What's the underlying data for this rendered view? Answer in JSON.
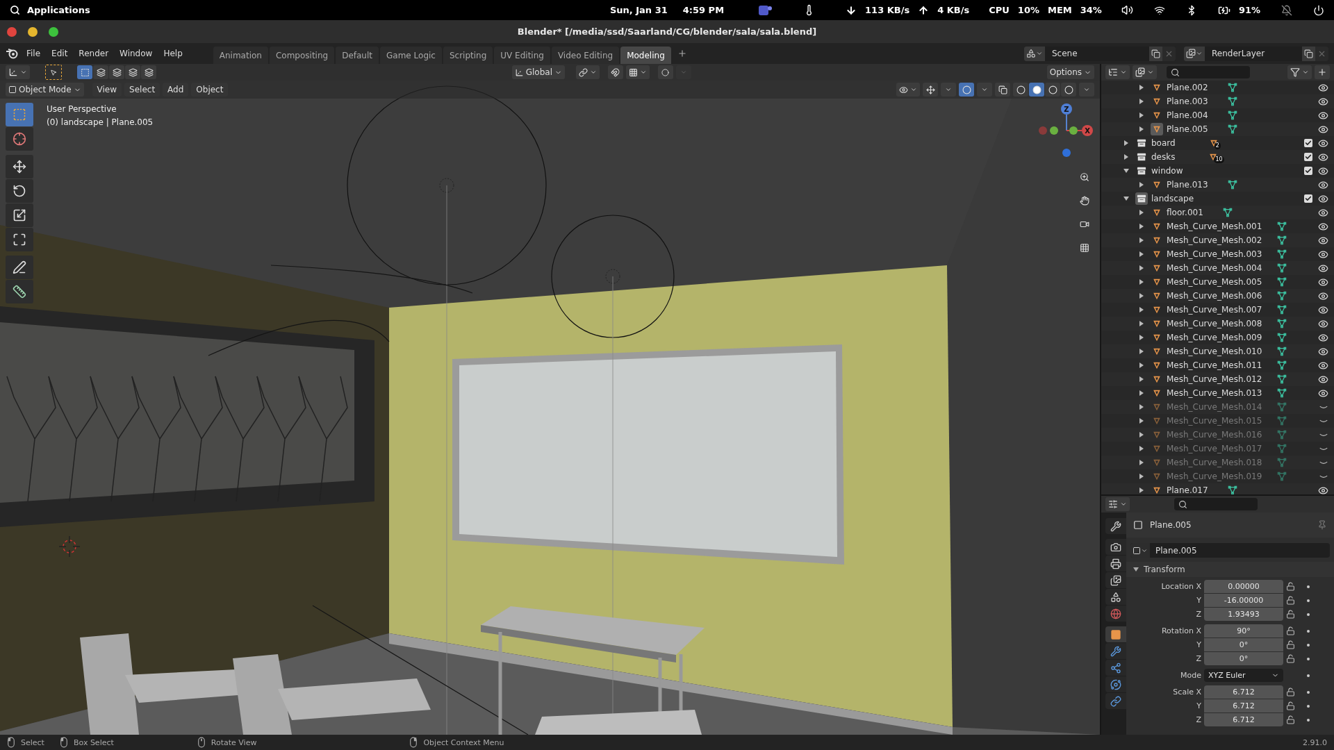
{
  "system_bar": {
    "launcher": "Applications",
    "date": "Sun, Jan 31",
    "time": "4:59 PM",
    "download": "113 KB/s",
    "upload": "4 KB/s",
    "cpu_label": "CPU",
    "cpu": "10%",
    "mem_label": "MEM",
    "mem": "34%",
    "battery": "91%"
  },
  "window": {
    "title": "Blender* [/media/ssd/Saarland/CG/blender/sala/sala.blend]"
  },
  "menu": [
    "File",
    "Edit",
    "Render",
    "Window",
    "Help"
  ],
  "workspaces": [
    {
      "label": "Animation",
      "selected": false
    },
    {
      "label": "Compositing",
      "selected": false
    },
    {
      "label": "Default",
      "selected": false
    },
    {
      "label": "Game Logic",
      "selected": false
    },
    {
      "label": "Scripting",
      "selected": false
    },
    {
      "label": "UV Editing",
      "selected": false
    },
    {
      "label": "Video Editing",
      "selected": false
    },
    {
      "label": "Modeling",
      "selected": true
    }
  ],
  "scene": "Scene",
  "view_layer": "RenderLayer",
  "tool_header": {
    "select_modes": [
      {
        "selected": true
      },
      {
        "selected": false
      },
      {
        "selected": false
      },
      {
        "selected": false
      },
      {
        "selected": false
      }
    ],
    "orientation": "Global",
    "options": "Options"
  },
  "viewport_header": {
    "mode": "Object Mode",
    "menus": [
      "View",
      "Select",
      "Add",
      "Object"
    ],
    "shading": [
      {
        "selected": false
      },
      {
        "selected": true
      },
      {
        "selected": false
      },
      {
        "selected": false
      }
    ]
  },
  "viewport": {
    "view_name": "User Perspective",
    "context": "(0) landscape | Plane.005",
    "gizmo_axes": [
      "X",
      "Z"
    ]
  },
  "toolbar": {
    "groups": [
      {
        "tools": [
          {
            "kind": "select",
            "selected": true
          },
          {
            "kind": "cursor",
            "selected": false
          }
        ]
      },
      {
        "tools": [
          {
            "kind": "move",
            "selected": false
          },
          {
            "kind": "rotate",
            "selected": false
          },
          {
            "kind": "scale",
            "selected": false
          },
          {
            "kind": "transform",
            "selected": false
          }
        ]
      },
      {
        "tools": [
          {
            "kind": "annotate",
            "selected": false
          },
          {
            "kind": "measure",
            "selected": false
          }
        ]
      }
    ]
  },
  "outliner": {
    "scrolled_children": [
      {
        "name": "Plane.002",
        "visible": true,
        "selected": false
      },
      {
        "name": "Plane.003",
        "visible": true,
        "selected": false
      },
      {
        "name": "Plane.004",
        "visible": true,
        "selected": false
      },
      {
        "name": "Plane.005",
        "visible": true,
        "selected": true
      }
    ],
    "collections": [
      {
        "name": "board",
        "count": "2",
        "expanded": false,
        "checked": true,
        "selected": false
      },
      {
        "name": "desks",
        "count": "10",
        "expanded": false,
        "checked": true,
        "selected": false
      },
      {
        "name": "window",
        "expanded": true,
        "checked": true,
        "selected": false,
        "children": [
          {
            "name": "Plane.013",
            "visible": true,
            "selected": false
          }
        ]
      },
      {
        "name": "landscape",
        "expanded": true,
        "checked": true,
        "selected": true,
        "children": [
          {
            "name": "floor.001",
            "visible": true,
            "selected": false
          },
          {
            "name": "Mesh_Curve_Mesh.001",
            "visible": true,
            "selected": false
          },
          {
            "name": "Mesh_Curve_Mesh.002",
            "visible": true,
            "selected": false
          },
          {
            "name": "Mesh_Curve_Mesh.003",
            "visible": true,
            "selected": false
          },
          {
            "name": "Mesh_Curve_Mesh.004",
            "visible": true,
            "selected": false
          },
          {
            "name": "Mesh_Curve_Mesh.005",
            "visible": true,
            "selected": false
          },
          {
            "name": "Mesh_Curve_Mesh.006",
            "visible": true,
            "selected": false
          },
          {
            "name": "Mesh_Curve_Mesh.007",
            "visible": true,
            "selected": false
          },
          {
            "name": "Mesh_Curve_Mesh.008",
            "visible": true,
            "selected": false
          },
          {
            "name": "Mesh_Curve_Mesh.009",
            "visible": true,
            "selected": false
          },
          {
            "name": "Mesh_Curve_Mesh.010",
            "visible": true,
            "selected": false
          },
          {
            "name": "Mesh_Curve_Mesh.011",
            "visible": true,
            "selected": false
          },
          {
            "name": "Mesh_Curve_Mesh.012",
            "visible": true,
            "selected": false
          },
          {
            "name": "Mesh_Curve_Mesh.013",
            "visible": true,
            "selected": false
          },
          {
            "name": "Mesh_Curve_Mesh.014",
            "visible": false,
            "selected": false
          },
          {
            "name": "Mesh_Curve_Mesh.015",
            "visible": false,
            "selected": false
          },
          {
            "name": "Mesh_Curve_Mesh.016",
            "visible": false,
            "selected": false
          },
          {
            "name": "Mesh_Curve_Mesh.017",
            "visible": false,
            "selected": false
          },
          {
            "name": "Mesh_Curve_Mesh.018",
            "visible": false,
            "selected": false
          },
          {
            "name": "Mesh_Curve_Mesh.019",
            "visible": false,
            "selected": false
          },
          {
            "name": "Plane.017",
            "visible": true,
            "selected": false
          }
        ]
      }
    ]
  },
  "properties": {
    "tabs": [
      {
        "kind": "tool",
        "selected": false
      },
      {
        "kind": "render",
        "selected": false
      },
      {
        "kind": "output",
        "selected": false
      },
      {
        "kind": "view_layer",
        "selected": false
      },
      {
        "kind": "scene",
        "selected": false
      },
      {
        "kind": "world",
        "selected": false
      },
      {
        "kind": "object",
        "selected": true
      },
      {
        "kind": "modifiers",
        "selected": false
      },
      {
        "kind": "particles",
        "selected": false
      },
      {
        "kind": "physics",
        "selected": false
      },
      {
        "kind": "constraints",
        "selected": false
      }
    ],
    "object_name": "Plane.005",
    "data_name": "Plane.005",
    "panel": {
      "title": "Transform",
      "expanded": true
    },
    "groups": [
      {
        "rows": [
          {
            "kind": "number",
            "label": "Location X",
            "value": "0.00000"
          },
          {
            "kind": "number",
            "label": "Y",
            "value": "-16.00000"
          },
          {
            "kind": "number",
            "label": "Z",
            "value": "1.93493"
          }
        ]
      },
      {
        "rows": [
          {
            "kind": "number",
            "label": "Rotation X",
            "value": "90°"
          },
          {
            "kind": "number",
            "label": "Y",
            "value": "0°"
          },
          {
            "kind": "number",
            "label": "Z",
            "value": "0°"
          }
        ]
      },
      {
        "rows": [
          {
            "kind": "dropdown",
            "label": "Mode",
            "value": "XYZ Euler"
          }
        ]
      },
      {
        "rows": [
          {
            "kind": "number",
            "label": "Scale X",
            "value": "6.712"
          },
          {
            "kind": "number",
            "label": "Y",
            "value": "6.712"
          },
          {
            "kind": "number",
            "label": "Z",
            "value": "6.712"
          }
        ]
      }
    ]
  },
  "status_bar": {
    "hints": [
      {
        "kind": "left",
        "label": "Select"
      },
      {
        "kind": "left_drag",
        "label": "Box Select"
      },
      {
        "kind": "middle",
        "label": "Rotate View"
      },
      {
        "kind": "right",
        "label": "Object Context Menu"
      }
    ],
    "version": "2.91.0"
  }
}
